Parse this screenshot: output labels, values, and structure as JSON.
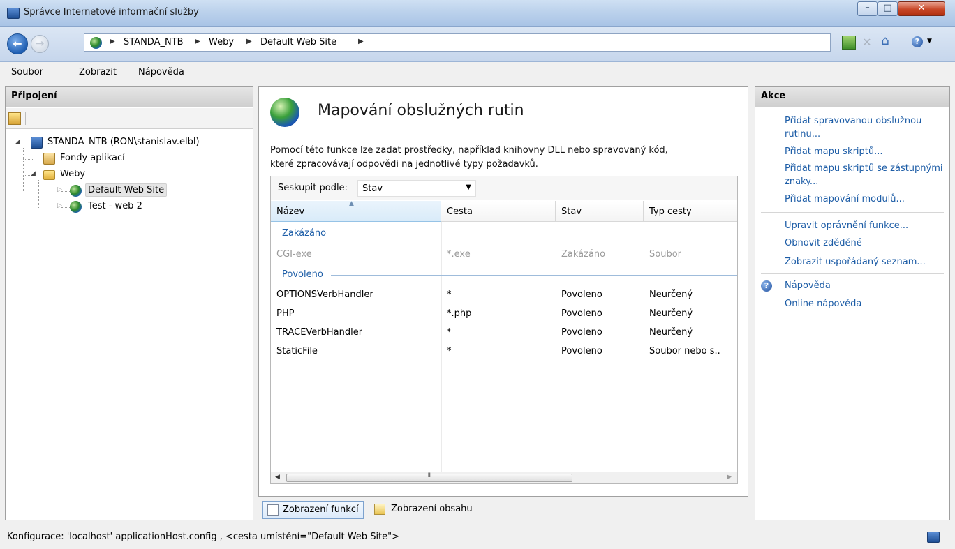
{
  "window": {
    "title": "Správce Internetové informační služby"
  },
  "address": {
    "crumbs": [
      "STANDA_NTB",
      "Weby",
      "Default Web Site"
    ]
  },
  "menu": [
    "Soubor",
    "Zobrazit",
    "Nápověda"
  ],
  "left_panel": {
    "header": "Připojení",
    "tree": {
      "server": "STANDA_NTB (RON\\stanislav.elbl)",
      "app_pools": "Fondy aplikací",
      "sites": "Weby",
      "site1": "Default Web Site",
      "site2": "Test - web 2"
    }
  },
  "center": {
    "title": "Mapování obslužných rutin",
    "description_line1": "Pomocí této funkce lze zadat prostředky, například knihovny DLL nebo spravovaný kód,",
    "description_line2": "které zpracovávají odpovědi na jednotlivé typy požadavků.",
    "group_by_label": "Seskupit podle:",
    "group_by_value": "Stav",
    "columns": [
      "Název",
      "Cesta",
      "Stav",
      "Typ cesty"
    ],
    "groups": [
      {
        "name": "Zakázáno",
        "rows": [
          {
            "name": "CGI-exe",
            "path": "*.exe",
            "state": "Zakázáno",
            "path_type": "Soubor"
          }
        ]
      },
      {
        "name": "Povoleno",
        "rows": [
          {
            "name": "OPTIONSVerbHandler",
            "path": "*",
            "state": "Povoleno",
            "path_type": "Neurčený"
          },
          {
            "name": "PHP",
            "path": "*.php",
            "state": "Povoleno",
            "path_type": "Neurčený"
          },
          {
            "name": "TRACEVerbHandler",
            "path": "*",
            "state": "Povoleno",
            "path_type": "Neurčený"
          },
          {
            "name": "StaticFile",
            "path": "*",
            "state": "Povoleno",
            "path_type": "Soubor nebo s.."
          }
        ]
      }
    ],
    "scroll_grip": "III",
    "view_tabs": [
      "Zobrazení funkcí",
      "Zobrazení obsahu"
    ]
  },
  "right_panel": {
    "header": "Akce",
    "actions1": [
      "Přidat spravovanou obslužnou rutinu...",
      "Přidat mapu skriptů...",
      "Přidat mapu skriptů se zástupnými znaky...",
      "Přidat mapování modulů..."
    ],
    "actions2": [
      "Upravit oprávnění funkce...",
      "Obnovit zděděné",
      "Zobrazit uspořádaný seznam..."
    ],
    "help": "Nápověda",
    "online_help": "Online nápověda"
  },
  "status": {
    "text": "Konfigurace: 'localhost' applicationHost.config , <cesta umístění=\"Default Web Site\">"
  }
}
